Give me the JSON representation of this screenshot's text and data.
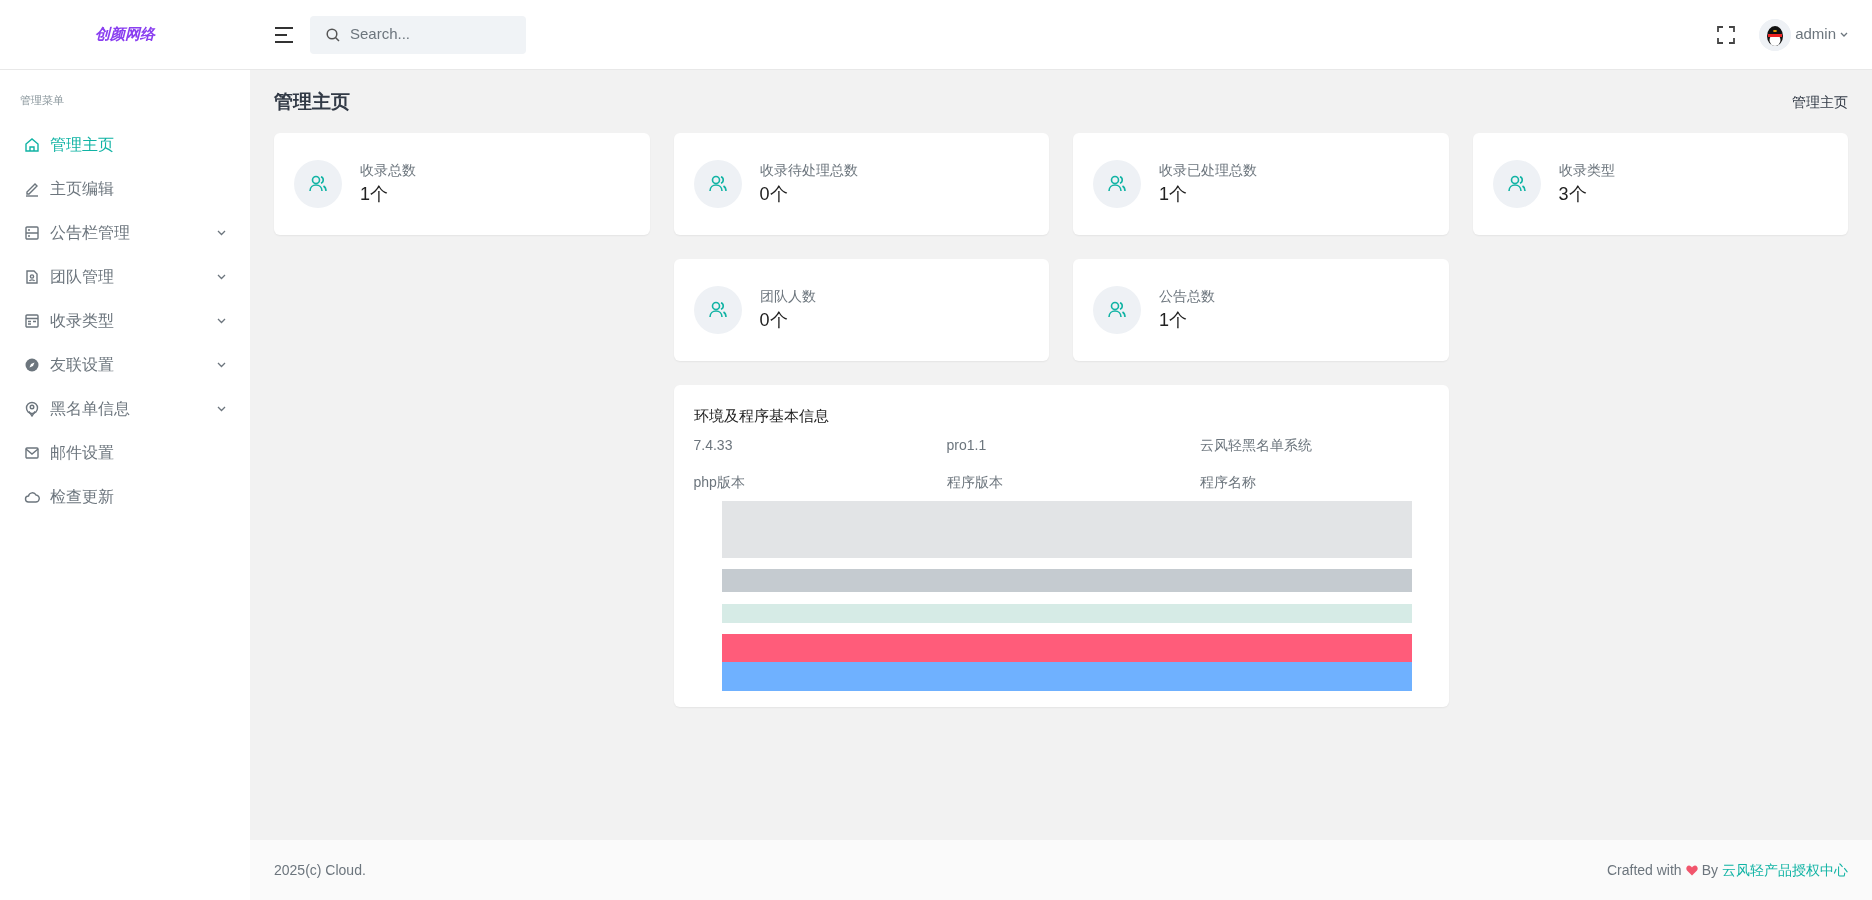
{
  "logo": {
    "text": "创颜网络"
  },
  "search": {
    "placeholder": "Search..."
  },
  "user": {
    "name": "admin"
  },
  "sidebar": {
    "heading": "管理菜单",
    "items": [
      {
        "label": "管理主页",
        "selected": true,
        "expandable": false
      },
      {
        "label": "主页编辑",
        "selected": false,
        "expandable": false
      },
      {
        "label": "公告栏管理",
        "selected": false,
        "expandable": true
      },
      {
        "label": "团队管理",
        "selected": false,
        "expandable": true
      },
      {
        "label": "收录类型",
        "selected": false,
        "expandable": true
      },
      {
        "label": "友联设置",
        "selected": false,
        "expandable": true
      },
      {
        "label": "黑名单信息",
        "selected": false,
        "expandable": true
      },
      {
        "label": "邮件设置",
        "selected": false,
        "expandable": false
      },
      {
        "label": "检查更新",
        "selected": false,
        "expandable": false
      }
    ]
  },
  "page": {
    "title": "管理主页",
    "breadcrumb": "管理主页"
  },
  "stats_row_1": [
    {
      "label": "收录总数",
      "value": "1个"
    },
    {
      "label": "收录待处理总数",
      "value": "0个"
    },
    {
      "label": "收录已处理总数",
      "value": "1个"
    },
    {
      "label": "收录类型",
      "value": "3个"
    }
  ],
  "stats_row_2": [
    {
      "label": "团队人数",
      "value": "0个"
    },
    {
      "label": "公告总数",
      "value": "1个"
    }
  ],
  "info": {
    "title": "环境及程序基本信息",
    "fields": [
      {
        "value": "7.4.33",
        "label": "php版本"
      },
      {
        "value": "pro1.1",
        "label": "程序版本"
      },
      {
        "value": "云风轻黑名单系统",
        "label": "程序名称"
      }
    ]
  },
  "footer": {
    "copyright": "2025(c) Cloud.",
    "crafted": "Crafted with",
    "by": "By",
    "link": "云风轻产品授权中心"
  }
}
